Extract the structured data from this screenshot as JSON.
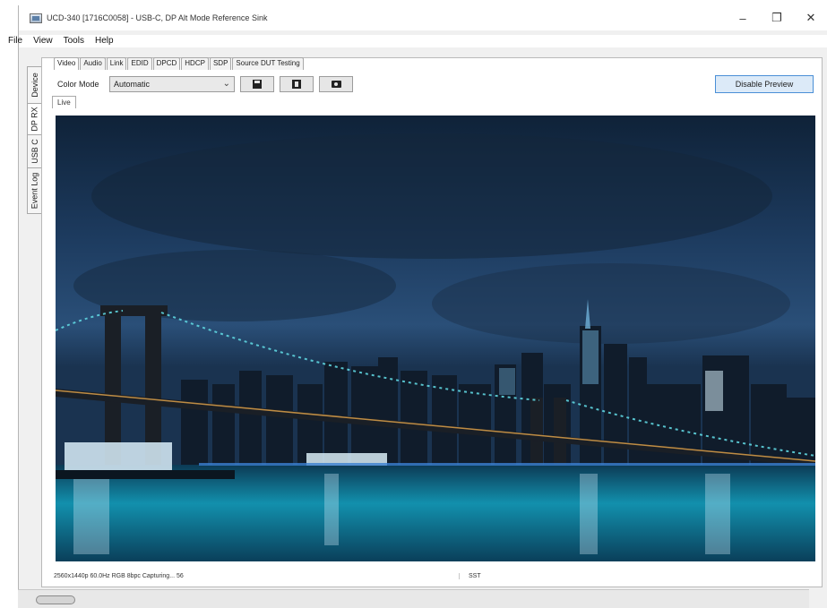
{
  "window": {
    "title": "UCD-340 [1716C0058] - USB-C, DP Alt Mode Reference Sink",
    "controls": {
      "minimize": "–",
      "maximize": "❐",
      "close": "✕"
    }
  },
  "menu": [
    "File",
    "View",
    "Tools",
    "Help"
  ],
  "side_tabs": [
    "Device",
    "DP RX",
    "USB C",
    "Event Log"
  ],
  "top_tabs": [
    "Video",
    "Audio",
    "Link",
    "EDID",
    "DPCD",
    "HDCP",
    "SDP",
    "Source DUT Testing"
  ],
  "toolbar": {
    "color_mode_label": "Color Mode",
    "color_mode_value": "Automatic",
    "buttons": [
      "save-icon",
      "save-as-icon",
      "camera-icon"
    ],
    "disable_preview_label": "Disable Preview"
  },
  "preview": {
    "tab_label": "Live"
  },
  "status": {
    "left": "2560x1440p 60.0Hz RGB 8bpc Capturing... 56",
    "right": "SST"
  }
}
